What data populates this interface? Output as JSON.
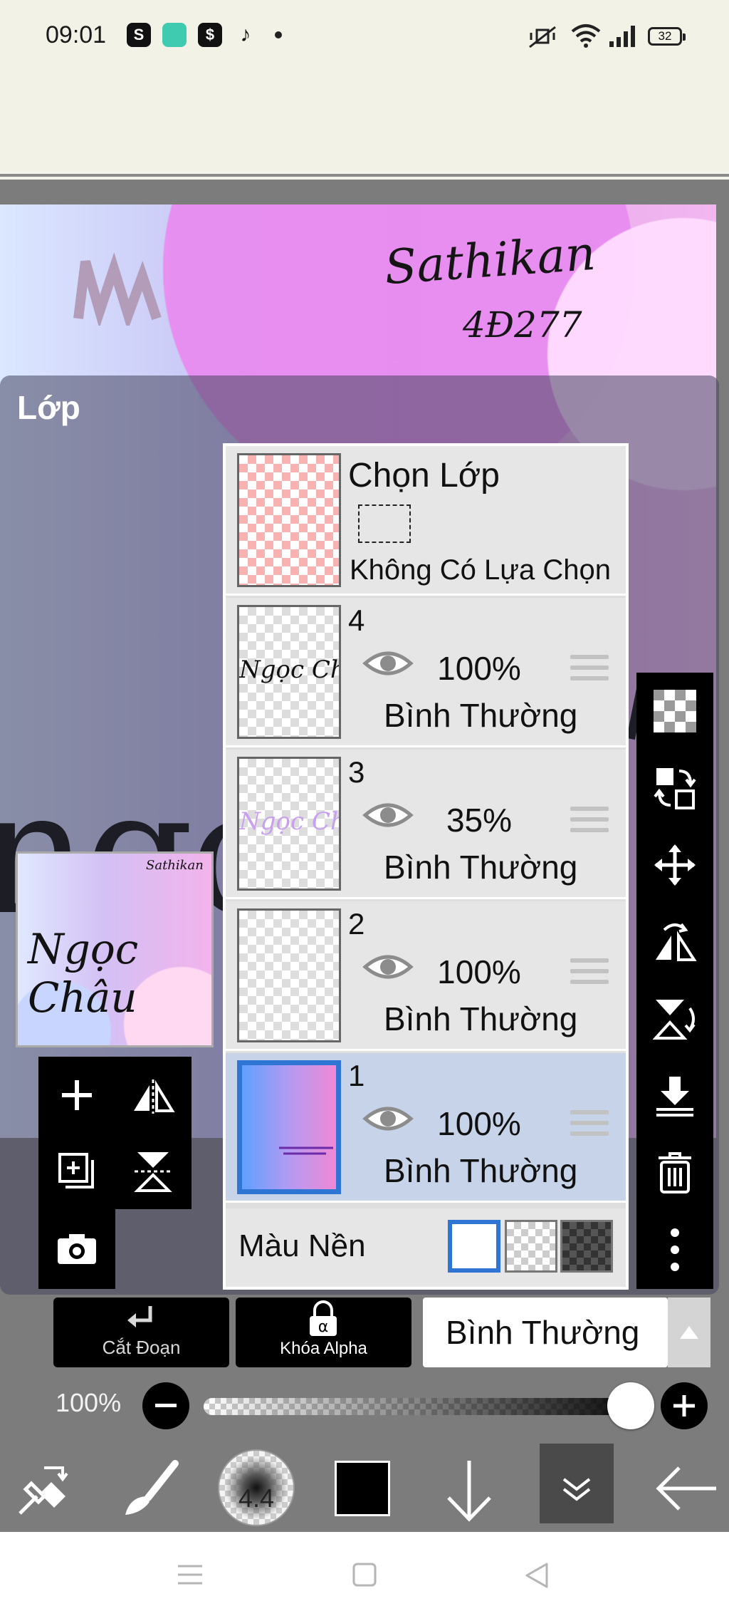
{
  "status_bar": {
    "time": "09:01",
    "battery": "32"
  },
  "artwork": {
    "signature_line1": "Sathikan",
    "signature_line2": "4Ð277",
    "big_text": "ngoc"
  },
  "panel": {
    "title": "Lớp"
  },
  "preview": {
    "text": "Ngọc Châu",
    "signature": "Sathikan"
  },
  "selection_layer": {
    "title": "Chọn Lớp",
    "subtitle": "Không Có Lựa Chọn"
  },
  "layers": [
    {
      "number": "4",
      "opacity": "100%",
      "blend": "Bình Thường",
      "thumb_text": "Ngọc Châu",
      "selected": false
    },
    {
      "number": "3",
      "opacity": "35%",
      "blend": "Bình Thường",
      "thumb_text": "Ngọc Châu",
      "selected": false
    },
    {
      "number": "2",
      "opacity": "100%",
      "blend": "Bình Thường",
      "thumb_text": "",
      "selected": false
    },
    {
      "number": "1",
      "opacity": "100%",
      "blend": "Bình Thường",
      "thumb_text": "",
      "selected": true
    }
  ],
  "background": {
    "label": "Màu Nền"
  },
  "actions": {
    "clip_label": "Cắt Đoạn",
    "alpha_lock_label": "Khóa Alpha",
    "blend_mode": "Bình Thường"
  },
  "opacity_slider": {
    "value": "100%",
    "level": 1.0
  },
  "toolbar": {
    "brush_size": "4.4",
    "color": "#000000"
  },
  "colors": {
    "accent": "#2f75d4",
    "selected_row": "#c7d3e8",
    "panel": "#dedede"
  }
}
